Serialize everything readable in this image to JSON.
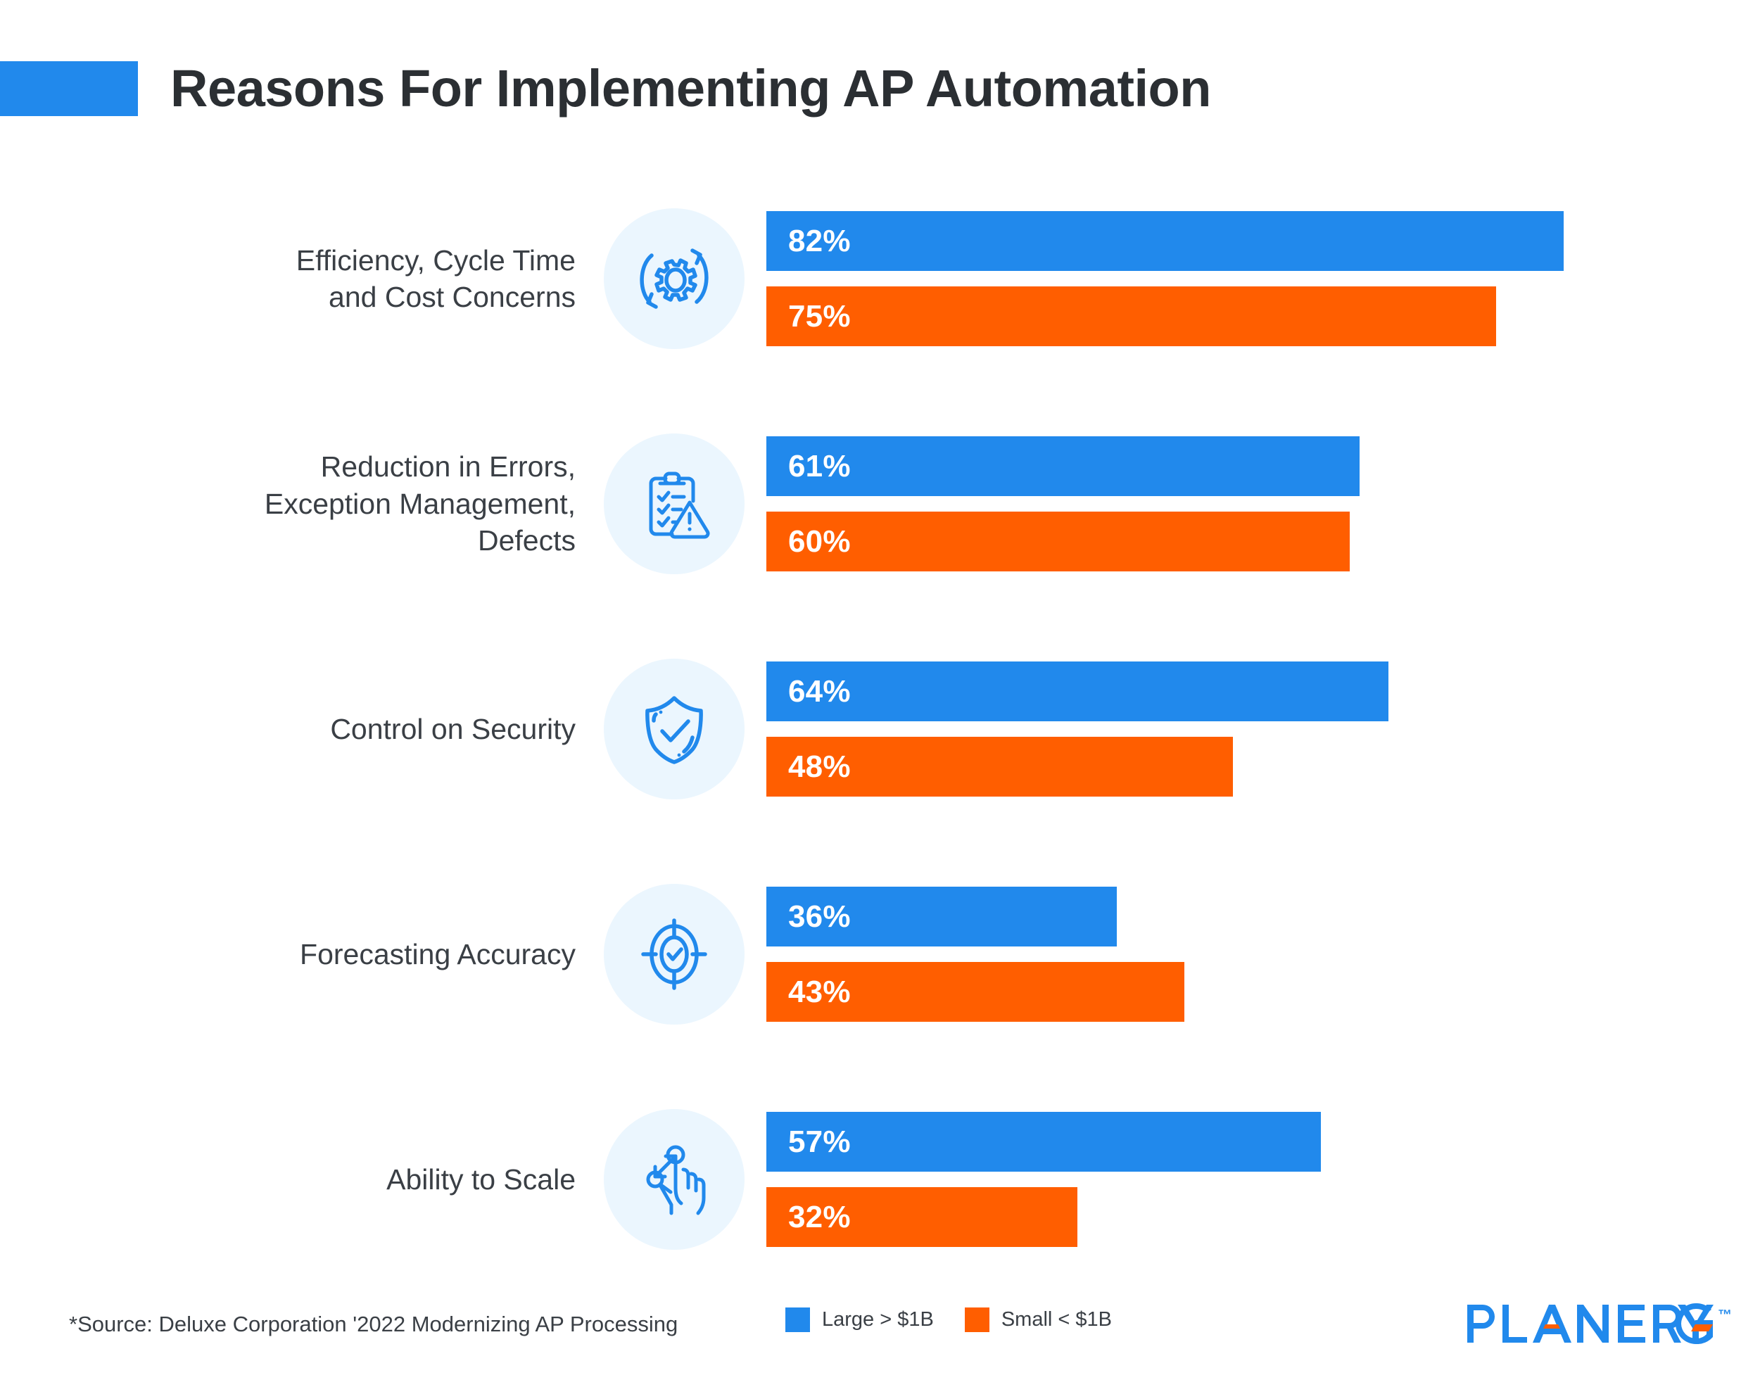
{
  "header": {
    "title": "Reasons For Implementing AP Automation",
    "accent_color": "#2189ec"
  },
  "chart_data": {
    "type": "bar",
    "orientation": "horizontal",
    "title": "Reasons For Implementing AP Automation",
    "xlabel": "",
    "ylabel": "",
    "xlim": [
      0,
      100
    ],
    "grid": false,
    "legend_position": "bottom-center",
    "value_suffix": "%",
    "categories": [
      "Efficiency, Cycle Time and Cost Concerns",
      "Reduction in Errors, Exception Management, Defects",
      "Control on Security",
      "Forecasting Accuracy",
      "Ability to Scale"
    ],
    "series": [
      {
        "name": "Large > $1B",
        "color": "#2189ec",
        "values": [
          82,
          61,
          64,
          36,
          57
        ]
      },
      {
        "name": "Small < $1B",
        "color": "#ff5e00",
        "values": [
          75,
          60,
          48,
          43,
          32
        ]
      }
    ],
    "source": "*Source: Deluxe Corporation '2022 Modernizing AP Processing"
  },
  "rows": [
    {
      "label_line1": "Efficiency, Cycle Time",
      "label_line2": "and Cost Concerns",
      "label_line3": "",
      "icon": "gear-cycle-icon",
      "large": {
        "value": 82,
        "display": "82%"
      },
      "small": {
        "value": 75,
        "display": "75%"
      }
    },
    {
      "label_line1": "Reduction in Errors,",
      "label_line2": "Exception Management,",
      "label_line3": "Defects",
      "icon": "clipboard-warning-icon",
      "large": {
        "value": 61,
        "display": "61%"
      },
      "small": {
        "value": 60,
        "display": "60%"
      }
    },
    {
      "label_line1": "Control on Security",
      "label_line2": "",
      "label_line3": "",
      "icon": "shield-check-icon",
      "large": {
        "value": 64,
        "display": "64%"
      },
      "small": {
        "value": 48,
        "display": "48%"
      }
    },
    {
      "label_line1": "Forecasting Accuracy",
      "label_line2": "",
      "label_line3": "",
      "icon": "target-check-icon",
      "large": {
        "value": 36,
        "display": "36%"
      },
      "small": {
        "value": 43,
        "display": "43%"
      }
    },
    {
      "label_line1": "Ability to Scale",
      "label_line2": "",
      "label_line3": "",
      "icon": "pinch-zoom-hand-icon",
      "large": {
        "value": 57,
        "display": "57%"
      },
      "small": {
        "value": 32,
        "display": "32%"
      }
    }
  ],
  "footer": {
    "source": "*Source: Deluxe Corporation '2022 Modernizing AP Processing",
    "legend": [
      {
        "label": "Large > $1B",
        "color": "#2189ec"
      },
      {
        "label": "Small < $1B",
        "color": "#ff5e00"
      }
    ],
    "logo": {
      "text": "PLANERGY",
      "trademark": "™",
      "color": "#2189ec",
      "accent_color": "#ff5e00"
    }
  }
}
